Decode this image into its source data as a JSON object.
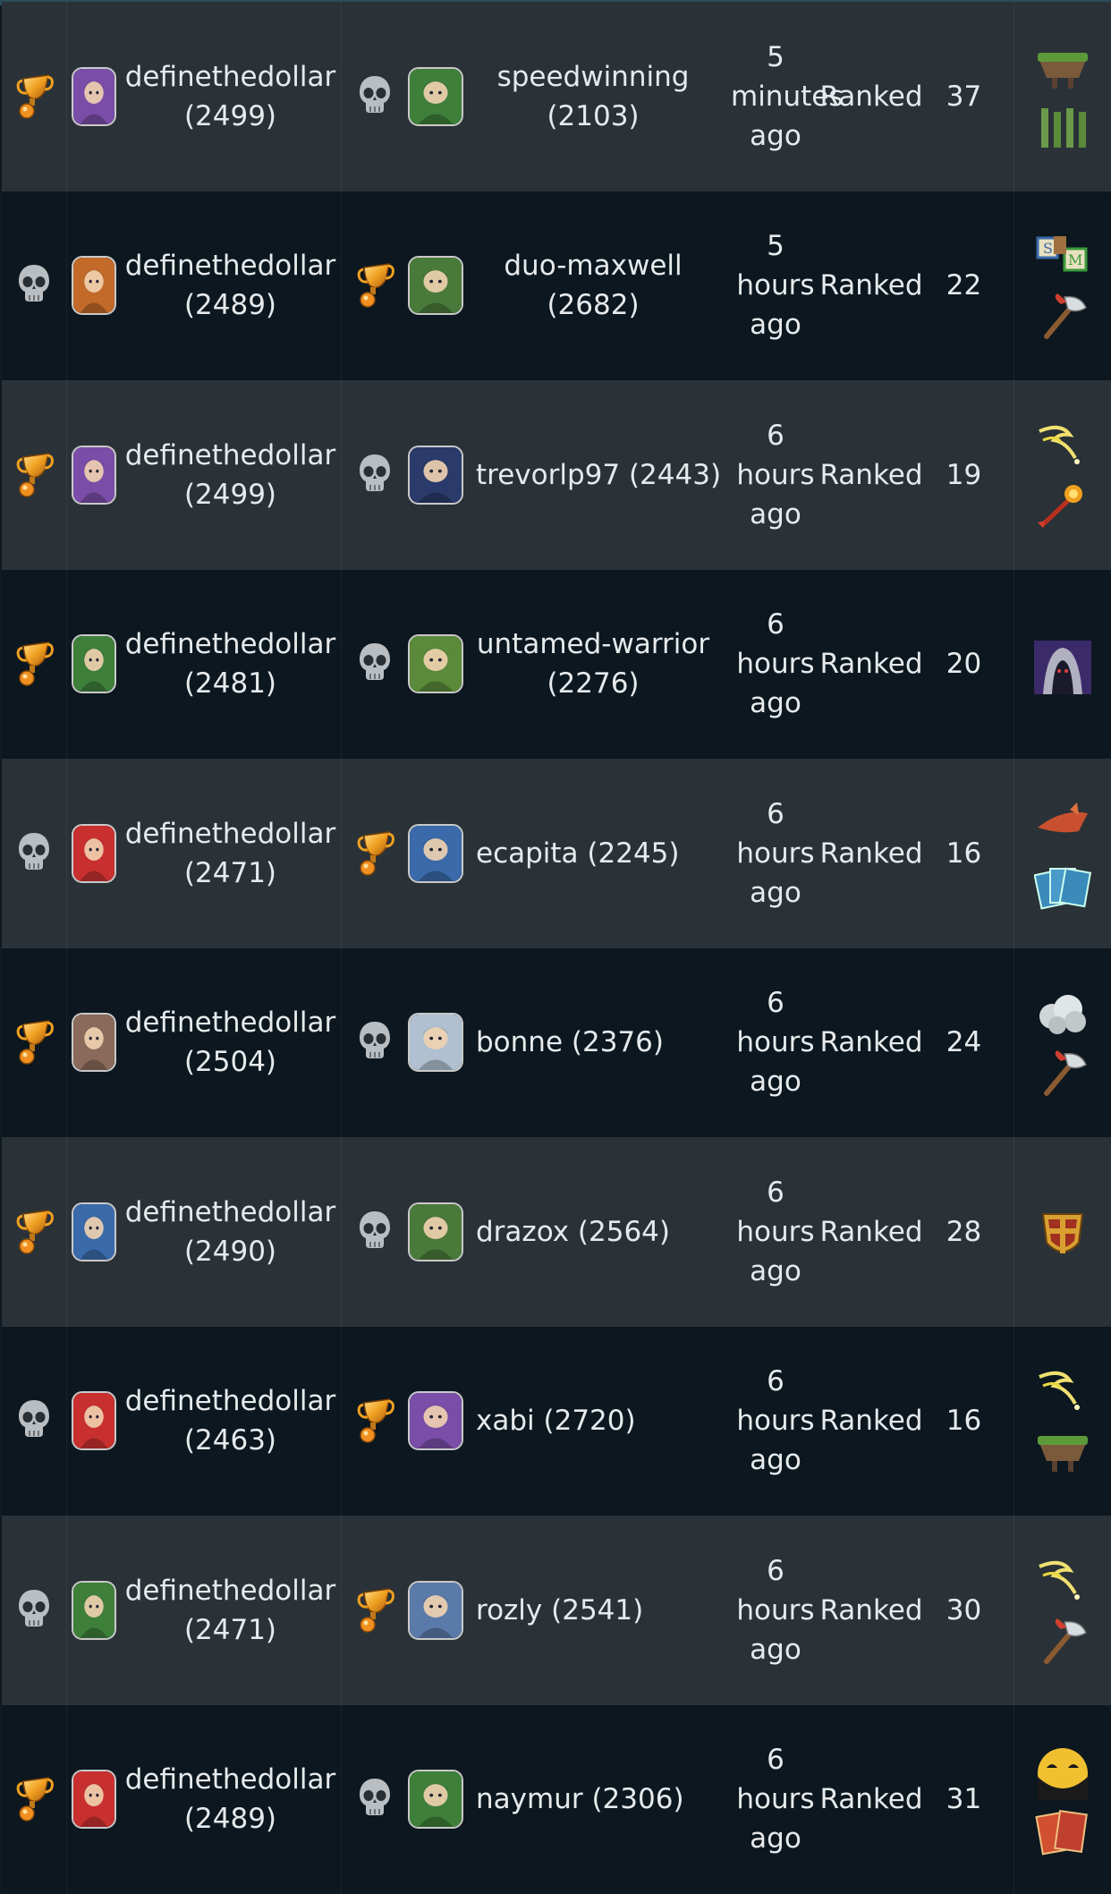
{
  "matches": [
    {
      "result1": "win",
      "player1": {
        "name": "definethedollar",
        "rating": "(2499)",
        "avatar_icon": "golden-knight-avatar",
        "avatar_color": "#7a4ea8"
      },
      "result2": "loss",
      "player2": {
        "name": "speedwinning",
        "rating": "(2103)",
        "avatar_icon": "elf-girl-avatar",
        "avatar_color": "#3e7f3a"
      },
      "player2_split": true,
      "time": "5 minutes ago",
      "mode": "Ranked",
      "turns": "37",
      "cards": [
        {
          "icon": "floating-island-card",
          "color": "#5c8a3a"
        },
        {
          "icon": "bars-card",
          "color": "#3a5a3a"
        }
      ]
    },
    {
      "result1": "loss",
      "player1": {
        "name": "definethedollar",
        "rating": "(2489)",
        "avatar_icon": "mech-warrior-avatar",
        "avatar_color": "#c26a2a"
      },
      "result2": "win",
      "player2": {
        "name": "duo-maxwell",
        "rating": "(2682)",
        "avatar_icon": "ranger-avatar",
        "avatar_color": "#4a7a3a"
      },
      "player2_split": true,
      "time": "5 hours ago",
      "mode": "Ranked",
      "turns": "22",
      "cards": [
        {
          "icon": "sm-blocks-card",
          "color": "#3a6a9a"
        },
        {
          "icon": "axe-card",
          "color": "#b08060"
        }
      ]
    },
    {
      "result1": "win",
      "player1": {
        "name": "definethedollar",
        "rating": "(2499)",
        "avatar_icon": "golden-knight-avatar",
        "avatar_color": "#7a4ea8"
      },
      "result2": "loss",
      "player2": {
        "name": "trevorlp97",
        "rating": "(2443)",
        "avatar_icon": "dark-mage-avatar",
        "avatar_color": "#2a3a6a"
      },
      "player2_split": false,
      "time": "6 hours ago",
      "mode": "Ranked",
      "turns": "19",
      "cards": [
        {
          "icon": "lightning-card",
          "color": "#d8d060"
        },
        {
          "icon": "explosive-arrow-card",
          "color": "#d04030"
        }
      ]
    },
    {
      "result1": "win",
      "player1": {
        "name": "definethedollar",
        "rating": "(2481)",
        "avatar_icon": "elf-girl-avatar",
        "avatar_color": "#3e7f3a"
      },
      "result2": "loss",
      "player2": {
        "name": "untamed-warrior",
        "rating": "(2276)",
        "avatar_icon": "lizard-warrior-avatar",
        "avatar_color": "#5a8a3a"
      },
      "player2_split": true,
      "time": "6 hours ago",
      "mode": "Ranked",
      "turns": "20",
      "cards": [
        {
          "icon": "hooded-figure-card",
          "color": "#5a3a8a"
        }
      ]
    },
    {
      "result1": "loss",
      "player1": {
        "name": "definethedollar",
        "rating": "(2471)",
        "avatar_icon": "red-dragon-avatar",
        "avatar_color": "#c83030"
      },
      "result2": "win",
      "player2": {
        "name": "ecapita",
        "rating": "(2245)",
        "avatar_icon": "wizard-avatar",
        "avatar_color": "#3a6aaa"
      },
      "player2_split": false,
      "time": "6 hours ago",
      "mode": "Ranked",
      "turns": "16",
      "cards": [
        {
          "icon": "fox-hat-card",
          "color": "#c05030"
        },
        {
          "icon": "card-deck-card",
          "color": "#3a7aaa"
        }
      ]
    },
    {
      "result1": "win",
      "player1": {
        "name": "definethedollar",
        "rating": "(2504)",
        "avatar_icon": "photo-face-avatar",
        "avatar_color": "#8a6a5a"
      },
      "result2": "loss",
      "player2": {
        "name": "bonne",
        "rating": "(2376)",
        "avatar_icon": "sleeping-avatar",
        "avatar_color": "#b0c0d0"
      },
      "player2_split": false,
      "time": "6 hours ago",
      "mode": "Ranked",
      "turns": "24",
      "cards": [
        {
          "icon": "smoke-cloud-card",
          "color": "#c0c8c8"
        },
        {
          "icon": "axe-card",
          "color": "#b08060"
        }
      ]
    },
    {
      "result1": "win",
      "player1": {
        "name": "definethedollar",
        "rating": "(2490)",
        "avatar_icon": "wizard-avatar",
        "avatar_color": "#3a6aaa"
      },
      "result2": "loss",
      "player2": {
        "name": "drazox",
        "rating": "(2564)",
        "avatar_icon": "old-sage-avatar",
        "avatar_color": "#4a7a3a"
      },
      "player2_split": false,
      "time": "6 hours ago",
      "mode": "Ranked",
      "turns": "28",
      "cards": [
        {
          "icon": "shield-card",
          "color": "#d0a030"
        }
      ]
    },
    {
      "result1": "loss",
      "player1": {
        "name": "definethedollar",
        "rating": "(2463)",
        "avatar_icon": "red-dragon-avatar",
        "avatar_color": "#c83030"
      },
      "result2": "win",
      "player2": {
        "name": "xabi",
        "rating": "(2720)",
        "avatar_icon": "golden-knight-avatar",
        "avatar_color": "#7a4ea8"
      },
      "player2_split": false,
      "time": "6 hours ago",
      "mode": "Ranked",
      "turns": "16",
      "cards": [
        {
          "icon": "lightning-card",
          "color": "#d8d060"
        },
        {
          "icon": "floating-island-card",
          "color": "#5c8a3a"
        }
      ]
    },
    {
      "result1": "loss",
      "player1": {
        "name": "definethedollar",
        "rating": "(2471)",
        "avatar_icon": "elf-girl-avatar",
        "avatar_color": "#3e7f3a"
      },
      "result2": "win",
      "player2": {
        "name": "rozly",
        "rating": "(2541)",
        "avatar_icon": "young-hero-avatar",
        "avatar_color": "#5a7aaa"
      },
      "player2_split": false,
      "time": "6 hours ago",
      "mode": "Ranked",
      "turns": "30",
      "cards": [
        {
          "icon": "lightning-card",
          "color": "#d8d060"
        },
        {
          "icon": "axe-card",
          "color": "#b08060"
        }
      ]
    },
    {
      "result1": "win",
      "player1": {
        "name": "definethedollar",
        "rating": "(2489)",
        "avatar_icon": "red-dragon-avatar",
        "avatar_color": "#c83030"
      },
      "result2": "loss",
      "player2": {
        "name": "naymur",
        "rating": "(2306)",
        "avatar_icon": "elf-girl-avatar",
        "avatar_color": "#3e7f3a"
      },
      "player2_split": false,
      "time": "6 hours ago",
      "mode": "Ranked",
      "turns": "31",
      "cards": [
        {
          "icon": "night-eyes-card",
          "color": "#e0b030"
        },
        {
          "icon": "spell-cards-card",
          "color": "#c04030"
        }
      ]
    }
  ]
}
